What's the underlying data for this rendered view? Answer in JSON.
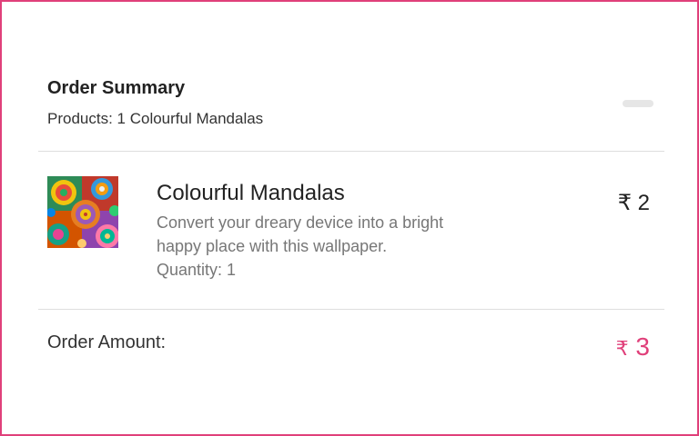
{
  "summary": {
    "title": "Order Summary",
    "products_line": "Products: 1 Colourful Mandalas"
  },
  "item": {
    "name": "Colourful Mandalas",
    "description": "Convert your dreary device into a bright happy place with this wallpaper.",
    "quantity_text": "Quantity: 1",
    "currency": "₹",
    "price": "2",
    "image_icon": "mandala-thumbnail"
  },
  "order": {
    "label": "Order Amount:",
    "currency": "₹",
    "amount": "3"
  },
  "colors": {
    "accent": "#e0407a",
    "border": "#e0407a",
    "muted_text": "#777777"
  }
}
